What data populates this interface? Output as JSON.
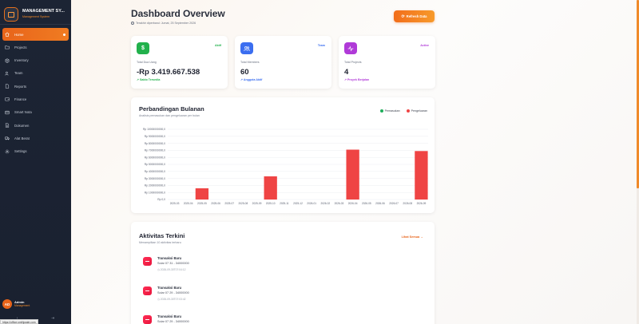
{
  "app": {
    "title": "MANAGEMENT SY...",
    "subtitle": "Management System"
  },
  "sidebar": {
    "items": [
      {
        "label": "Home",
        "icon": "home-icon",
        "active": true
      },
      {
        "label": "Projects",
        "icon": "folder-icon",
        "active": false
      },
      {
        "label": "Inventory",
        "icon": "box-icon",
        "active": false
      },
      {
        "label": "Team",
        "icon": "users-icon",
        "active": false
      },
      {
        "label": "Reports",
        "icon": "file-icon",
        "active": false
      },
      {
        "label": "Finance",
        "icon": "wallet-icon",
        "active": false
      },
      {
        "label": "Smart Nota",
        "icon": "receipt-icon",
        "active": false
      },
      {
        "label": "Dokumen",
        "icon": "document-icon",
        "active": false
      },
      {
        "label": "Alat Berat",
        "icon": "truck-icon",
        "active": false
      },
      {
        "label": "Settings",
        "icon": "gear-icon",
        "active": false
      }
    ],
    "user": {
      "initials": "AD",
      "name": "Admin",
      "role": "Management"
    },
    "bottom": {
      "collapse": "‹",
      "logout": "⇥"
    },
    "status_url": "https://office.smthjwale.com"
  },
  "header": {
    "title": "Dashboard Overview",
    "updated": "Terakhir diperbarui: Jumat, 25 September 2026",
    "refresh_label": "Refresh Data"
  },
  "stats": [
    {
      "label": "Total Dua Uang",
      "value": "-Rp 3.419.667.538",
      "badge": "Aktif",
      "note": "Saldo Tersedia",
      "color": "#22b14c",
      "icon": "dollar-icon",
      "glyph": "$"
    },
    {
      "label": "Total Members",
      "value": "60",
      "badge": "Team",
      "note": "Anggota Aktif",
      "color": "#3b6ef0",
      "icon": "users-icon",
      "glyph": ""
    },
    {
      "label": "Total Projects",
      "value": "4",
      "badge": "Active",
      "note": "Proyek Berjalan",
      "color": "#b03ad8",
      "icon": "activity-icon",
      "glyph": ""
    }
  ],
  "chart": {
    "title": "Perbandingan Bulanan",
    "subtitle": "Analisis pemasukan dan pengeluaran per bulan",
    "legend": [
      {
        "name": "Pemasukan",
        "color": "#1fae5b"
      },
      {
        "name": "Pengeluaran",
        "color": "#ef4444"
      }
    ]
  },
  "chart_data": {
    "type": "bar",
    "categories": [
      "2025-03",
      "2025-04",
      "2025-05",
      "2025-06",
      "2025-07",
      "2025-08",
      "2025-09",
      "2025-10",
      "2025-11",
      "2025-12",
      "2026-01",
      "2026-02",
      "2026-03",
      "2026-04",
      "2026-05",
      "2026-06",
      "2026-07",
      "2026-08",
      "2026-09"
    ],
    "y_tick_labels": [
      "Rp 0,0",
      "Rp 1000000000,0",
      "Rp 2000000000,0",
      "Rp 3000000000,0",
      "Rp 4000000000,0",
      "Rp 5000000000,0",
      "Rp 6000000000,0",
      "Rp 7000000000,0",
      "Rp 8000000000,0",
      "Rp 9000000000,0",
      "Rp 10000000000,0"
    ],
    "ylim": [
      0,
      10000000000
    ],
    "series": [
      {
        "name": "Pemasukan",
        "values": [
          0,
          0,
          0,
          0,
          0,
          0,
          0,
          0,
          0,
          0,
          0,
          0,
          0,
          0,
          0,
          0,
          0,
          0,
          0
        ]
      },
      {
        "name": "Pengeluaran",
        "values": [
          0,
          0,
          1600000000,
          0,
          0,
          0,
          0,
          3300000000,
          0,
          0,
          0,
          0,
          0,
          7100000000,
          0,
          0,
          0,
          0,
          6900000000
        ]
      }
    ],
    "grid": true,
    "legend_position": "top-right"
  },
  "activity": {
    "title": "Aktivitas Terkini",
    "subtitle": "Menampilkan 10 aktivitas terbaru",
    "see_all": "Lihat Semua →",
    "items": [
      {
        "name": "Transaksi Baru",
        "desc": "Solar 07 31 - 34000000",
        "time": "2026-09-30T07:04:12"
      },
      {
        "name": "Transaksi Baru",
        "desc": "Solar 07 29 - 34000000",
        "time": "2026-09-30T07:03:42"
      },
      {
        "name": "Transaksi Baru",
        "desc": "Solar 07 29 - 34000000",
        "time": ""
      }
    ]
  }
}
